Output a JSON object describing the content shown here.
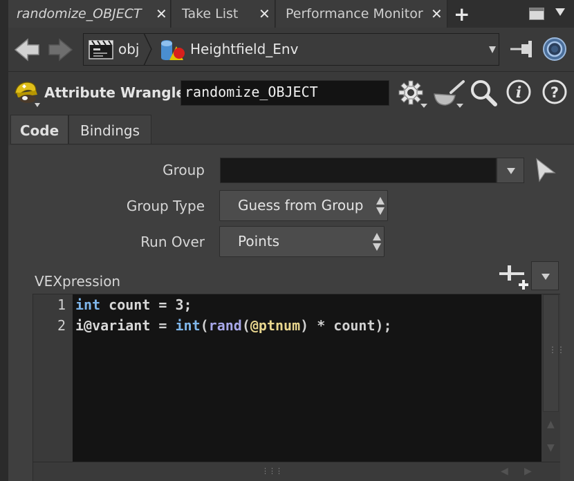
{
  "tabs": [
    {
      "label": "randomize_OBJECT",
      "active": true
    },
    {
      "label": "Take List",
      "active": false
    },
    {
      "label": "Performance Monitor",
      "active": false
    }
  ],
  "path": {
    "context": "obj",
    "node": "Heightfield_Env"
  },
  "node": {
    "type_label": "Attribute Wrangle",
    "name": "randomize_OBJECT"
  },
  "param_tabs": [
    "Code",
    "Bindings"
  ],
  "params": {
    "group_label": "Group",
    "group_value": "",
    "group_type_label": "Group Type",
    "group_type_value": "Guess from Group",
    "run_over_label": "Run Over",
    "run_over_value": "Points",
    "vex_label": "VEXpression"
  },
  "code": {
    "line_numbers": [
      "1",
      "2"
    ],
    "line1": {
      "kw": "int",
      "rest": " count = 3;"
    },
    "line2": {
      "a": "i@variant",
      "b": " = ",
      "c": "int",
      "d": "(",
      "e": "rand",
      "f": "(",
      "g": "@ptnum",
      "h": ") * count);"
    }
  },
  "colors": {
    "background": "#3a3a3a",
    "code_bg": "#141414",
    "keyword": "#7fb6ea",
    "function": "#a8a8ea",
    "attribute": "#e8d68e"
  },
  "icons": [
    "back-arrow-icon",
    "forward-arrow-icon",
    "obj-network-icon",
    "geo-node-icon",
    "pin-icon",
    "link-icon",
    "wrangle-icon",
    "gear-icon",
    "wok-icon",
    "search-icon",
    "info-icon",
    "help-icon",
    "select-arrow-icon",
    "presets-icon"
  ]
}
